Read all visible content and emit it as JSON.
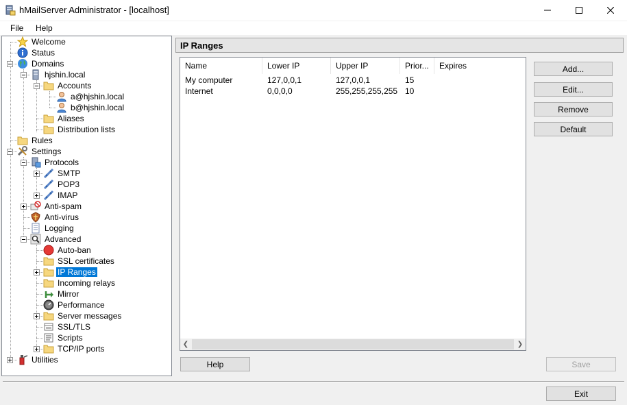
{
  "window": {
    "title": "hMailServer Administrator - [localhost]",
    "minimize_icon": "minimize-icon",
    "maximize_icon": "maximize-icon",
    "close_icon": "close-icon"
  },
  "menu": {
    "file": "File",
    "help": "Help"
  },
  "tree": {
    "welcome": "Welcome",
    "status": "Status",
    "domains": "Domains",
    "domain": "hjshin.local",
    "accounts": "Accounts",
    "account_a": "a@hjshin.local",
    "account_b": "b@hjshin.local",
    "aliases": "Aliases",
    "distribution_lists": "Distribution lists",
    "rules": "Rules",
    "settings": "Settings",
    "protocols": "Protocols",
    "smtp": "SMTP",
    "pop3": "POP3",
    "imap": "IMAP",
    "antispam": "Anti-spam",
    "antivirus": "Anti-virus",
    "logging": "Logging",
    "advanced": "Advanced",
    "autoban": "Auto-ban",
    "ssl_certificates": "SSL certificates",
    "ip_ranges": "IP Ranges",
    "incoming_relays": "Incoming relays",
    "mirror": "Mirror",
    "performance": "Performance",
    "server_messages": "Server messages",
    "ssl_tls": "SSL/TLS",
    "scripts": "Scripts",
    "tcpip_ports": "TCP/IP ports",
    "utilities": "Utilities"
  },
  "content": {
    "header": "IP Ranges",
    "columns": {
      "name": "Name",
      "lower_ip": "Lower IP",
      "upper_ip": "Upper IP",
      "priority": "Prior...",
      "expires": "Expires"
    },
    "rows": [
      {
        "name": "My computer",
        "lower_ip": "127,0,0,1",
        "upper_ip": "127,0,0,1",
        "priority": "15",
        "expires": ""
      },
      {
        "name": "Internet",
        "lower_ip": "0,0,0,0",
        "upper_ip": "255,255,255,255",
        "priority": "10",
        "expires": ""
      }
    ],
    "buttons": {
      "add": "Add...",
      "edit": "Edit...",
      "remove": "Remove",
      "default": "Default"
    },
    "help": "Help",
    "save": "Save",
    "exit": "Exit"
  }
}
